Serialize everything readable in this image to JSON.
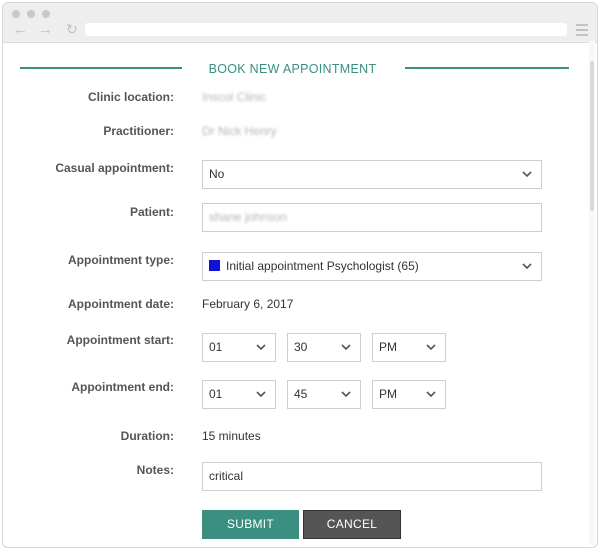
{
  "form": {
    "title": "BOOK NEW APPOINTMENT",
    "labels": {
      "clinic_location": "Clinic location:",
      "practitioner": "Practitioner:",
      "casual_appointment": "Casual appointment:",
      "patient": "Patient:",
      "appointment_type": "Appointment type:",
      "appointment_date": "Appointment date:",
      "appointment_start": "Appointment start:",
      "appointment_end": "Appointment end:",
      "duration": "Duration:",
      "notes": "Notes:"
    },
    "values": {
      "clinic_location": "Inscol Clinic",
      "practitioner": "Dr Nick Henry",
      "casual_appointment": "No",
      "patient": "shane johnson",
      "appointment_type": "Initial appointment Psychologist (65)",
      "appointment_type_color": "#1111d6",
      "appointment_date": "February 6, 2017",
      "start_hour": "01",
      "start_minute": "30",
      "start_ampm": "PM",
      "end_hour": "01",
      "end_minute": "45",
      "end_ampm": "PM",
      "duration": "15 minutes",
      "notes": "critical"
    },
    "buttons": {
      "submit": "SUBMIT",
      "cancel": "CANCEL"
    }
  },
  "colors": {
    "accent": "#3a8f80",
    "cancel": "#555555"
  }
}
